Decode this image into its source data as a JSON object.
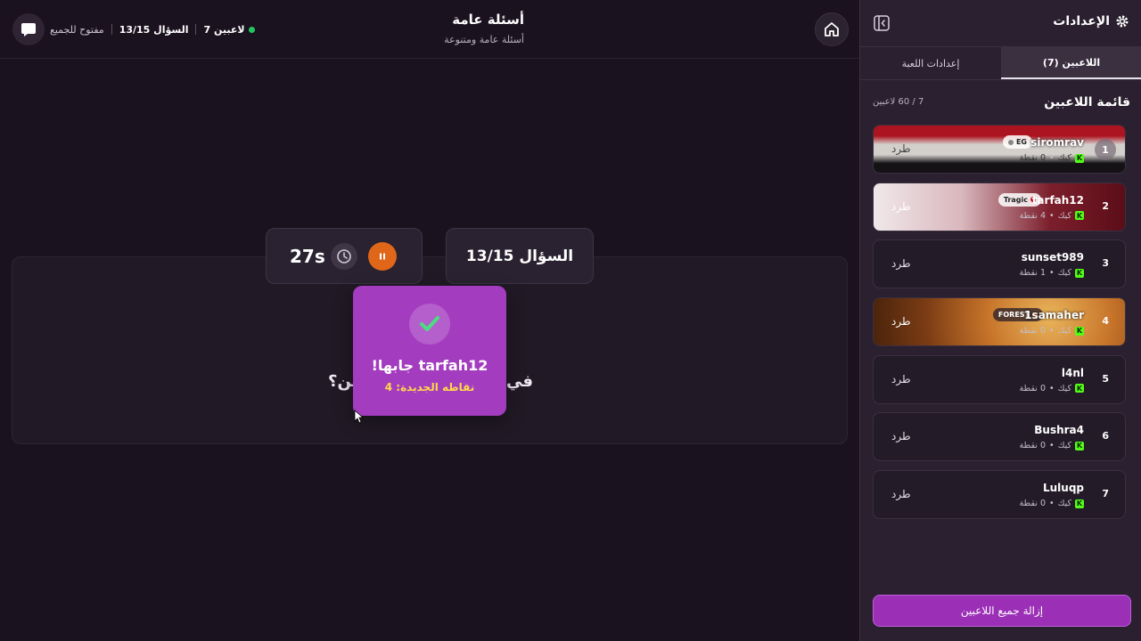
{
  "header": {
    "game_title": "أسئلة عامة",
    "game_subtitle": "أسئلة عامة ومتنوعة",
    "players_online": "7 لاعبين",
    "question_progress": "السؤال 13/15",
    "room_status": "مفتوح للجميع",
    "online_color": "#22c55e"
  },
  "game": {
    "timer": "27s",
    "question_counter": "السؤال 13/15",
    "question_left_fragment": "ين؟",
    "question_right_fragment": "في",
    "toast_title": "tarfah12 جابها!",
    "toast_subtitle": "نقاطه الجديدة: 4",
    "pause_color": "#e0661a",
    "toast_color": "#a43cc0"
  },
  "sidebar": {
    "title": "الإعدادات",
    "tabs": [
      {
        "label": "اللاعبين (7)",
        "active": true
      },
      {
        "label": "إعدادات اللعبة",
        "active": false
      }
    ],
    "list_title": "قائمة اللاعبين",
    "list_count": "7 / 60 لاعبين",
    "kick_label": "طرد",
    "remove_all_label": "إزالة جميع اللاعبين",
    "players": [
      {
        "rank": "1",
        "name": "siromrav",
        "meta_platform": "كيك",
        "meta_points": "0 نقطة",
        "badge": "EG",
        "theme": "egypt"
      },
      {
        "rank": "2",
        "name": "tarfah12",
        "meta_platform": "كيك",
        "meta_points": "4 نقطة",
        "badge": "Tragic",
        "theme": "anime"
      },
      {
        "rank": "3",
        "name": "sunset989",
        "meta_platform": "كيك",
        "meta_points": "1 نقطة",
        "badge": "",
        "theme": "plain"
      },
      {
        "rank": "4",
        "name": "1samaher",
        "meta_platform": "كيك",
        "meta_points": "0 نقطة",
        "badge": "FOREST",
        "theme": "forest"
      },
      {
        "rank": "5",
        "name": "l4nl",
        "meta_platform": "كيك",
        "meta_points": "0 نقطة",
        "badge": "",
        "theme": "plain"
      },
      {
        "rank": "6",
        "name": "Bushra4",
        "meta_platform": "كيك",
        "meta_points": "0 نقطة",
        "badge": "",
        "theme": "plain"
      },
      {
        "rank": "7",
        "name": "Luluqp",
        "meta_platform": "كيك",
        "meta_points": "0 نقطة",
        "badge": "",
        "theme": "plain"
      }
    ]
  }
}
